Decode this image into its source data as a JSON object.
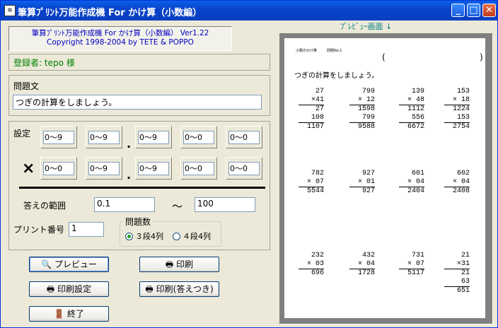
{
  "window": {
    "title": "筆算ﾌﾟﾘﾝﾄ万能作成機 For かけ算（小数編）",
    "minimize": "_",
    "maximize": "□",
    "close": "✕",
    "app_icon": "document-icon"
  },
  "app_info": {
    "line1": "筆算ﾌﾟﾘﾝﾄ万能作成機 For かけ算（小数編） Ver1.22",
    "line2": "Copyright 1998-2004 by TETE & POPPO"
  },
  "user": {
    "text": "登録者: tepo 様"
  },
  "question": {
    "label": "問題文",
    "value": "つぎの計算をしましょう。"
  },
  "settings": {
    "label": "設定",
    "row1": [
      "0～9",
      "0～9",
      "0～9",
      "0～0",
      "0～0"
    ],
    "row2": [
      "0～0",
      "0～9",
      "0～9",
      "0～0",
      "0～0"
    ],
    "dot": ".",
    "times": "×"
  },
  "answer_range": {
    "label": "答えの範囲",
    "from": "0.1",
    "tilde": "～",
    "to": "100"
  },
  "print_number": {
    "label": "プリント番号",
    "value": "1"
  },
  "problem_count": {
    "label": "問題数",
    "option1": "３段4列",
    "option2": "４段4列",
    "selected": "option1"
  },
  "buttons": {
    "preview": "プレビュー",
    "print": "印刷",
    "print_setup": "印刷設定",
    "print_answers": "印刷(答えつき)",
    "exit": "終了"
  },
  "preview": {
    "label": "ﾌﾟﾚﾋﾞｭｰ画面 ↓",
    "header_title": "小数のかけ算",
    "header_no": "問題No.1",
    "paren_open": "(",
    "paren_close": ")",
    "instruction": "つぎの計算をしましょう。",
    "problems": [
      {
        "a": "27",
        "b": "×41",
        "p1": "27",
        "p2": "108",
        "ans": "1107"
      },
      {
        "a": "799",
        "b": "× 12",
        "p1": "1598",
        "p2": "799",
        "ans": "9588"
      },
      {
        "a": "139",
        "b": "× 48",
        "p1": "1112",
        "p2": "556",
        "ans": "6672"
      },
      {
        "a": "153",
        "b": "× 18",
        "p1": "1224",
        "p2": "153",
        "ans": "2754"
      },
      {
        "a": "782",
        "b": "× 07",
        "ans": "5544"
      },
      {
        "a": "927",
        "b": "× 01",
        "ans": "927"
      },
      {
        "a": "601",
        "b": "× 04",
        "ans": "2404"
      },
      {
        "a": "602",
        "b": "× 04",
        "ans": "2408"
      },
      {
        "a": "232",
        "b": "× 03",
        "ans": "696"
      },
      {
        "a": "432",
        "b": "× 04",
        "ans": "1728"
      },
      {
        "a": "731",
        "b": "× 07",
        "ans": "5117"
      },
      {
        "a": "21",
        "b": "×31",
        "p1": "21",
        "p2": "63",
        "ans": "651"
      }
    ]
  }
}
